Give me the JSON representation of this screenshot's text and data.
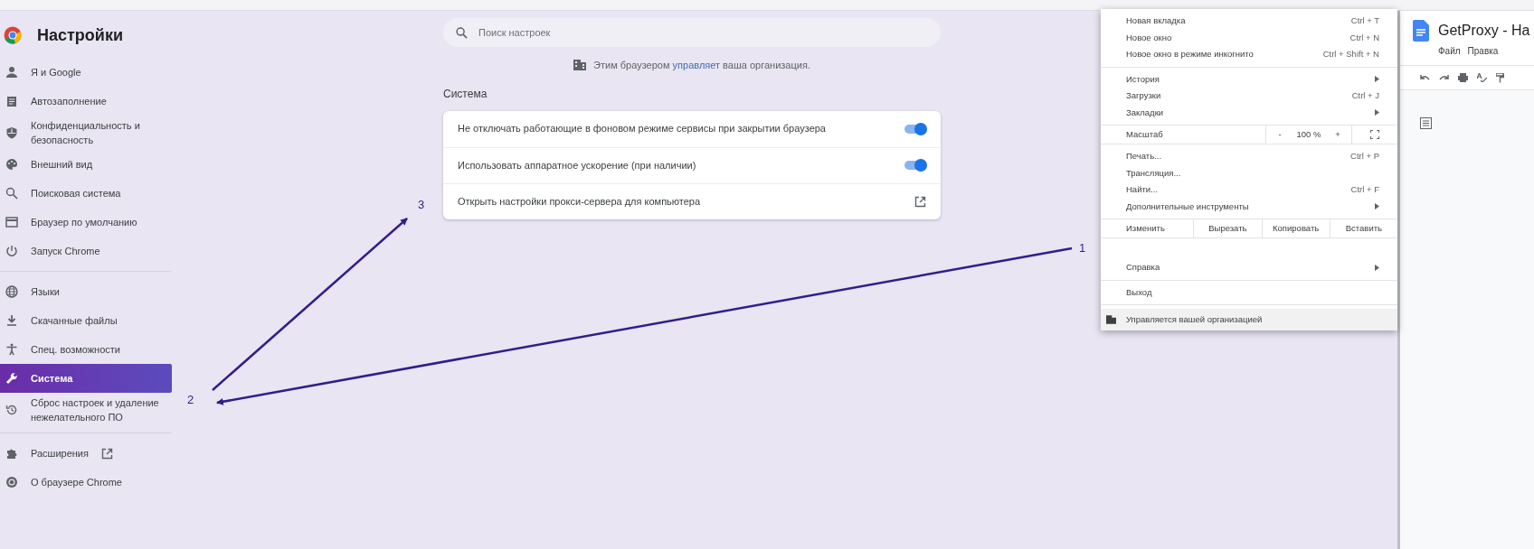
{
  "sidebar": {
    "title": "Настройки",
    "groups": [
      [
        {
          "label": "Я и Google",
          "selected": false,
          "external": false
        },
        {
          "label": "Автозаполнение",
          "selected": false,
          "external": false
        },
        {
          "label": "Конфиденциальность и безопасность",
          "selected": false,
          "external": false
        },
        {
          "label": "Внешний вид",
          "selected": false,
          "external": false
        },
        {
          "label": "Поисковая система",
          "selected": false,
          "external": false
        },
        {
          "label": "Браузер по умолчанию",
          "selected": false,
          "external": false
        },
        {
          "label": "Запуск Chrome",
          "selected": false,
          "external": false
        }
      ],
      [
        {
          "label": "Языки",
          "selected": false,
          "external": false
        },
        {
          "label": "Скачанные файлы",
          "selected": false,
          "external": false
        },
        {
          "label": "Спец. возможности",
          "selected": false,
          "external": false
        },
        {
          "label": "Система",
          "selected": true,
          "external": false
        },
        {
          "label": "Сброс настроек и удаление нежелательного ПО",
          "selected": false,
          "external": false
        }
      ],
      [
        {
          "label": "Расширения",
          "selected": false,
          "external": true
        },
        {
          "label": "О браузере Chrome",
          "selected": false,
          "external": false
        }
      ]
    ]
  },
  "search": {
    "placeholder": "Поиск настроек"
  },
  "managed_notice": {
    "before": "Этим браузером",
    "link": "управляет",
    "after": "ваша организация."
  },
  "section": {
    "title": "Система",
    "rows": [
      {
        "kind": "toggle",
        "label": "Не отключать работающие в фоновом режиме сервисы при закрытии браузера",
        "on": true
      },
      {
        "kind": "toggle",
        "label": "Использовать аппаратное ускорение (при наличии)",
        "on": true
      },
      {
        "kind": "link",
        "label": "Открыть настройки прокси-сервера для компьютера"
      }
    ]
  },
  "menu": {
    "items": [
      {
        "kind": "item",
        "label": "Новая вкладка",
        "shortcut": "Ctrl + T",
        "submenu": false
      },
      {
        "kind": "item",
        "label": "Новое окно",
        "shortcut": "Ctrl + N",
        "submenu": false
      },
      {
        "kind": "item",
        "label": "Новое окно в режиме инкогнито",
        "shortcut": "Ctrl + Shift + N",
        "submenu": false
      },
      {
        "kind": "divider"
      },
      {
        "kind": "item",
        "label": "История",
        "submenu": true
      },
      {
        "kind": "item",
        "label": "Загрузки",
        "shortcut": "Ctrl + J",
        "submenu": false
      },
      {
        "kind": "item",
        "label": "Закладки",
        "submenu": true
      },
      {
        "kind": "divider"
      },
      {
        "kind": "zoom",
        "label": "Масштаб",
        "minus": "-",
        "value": "100 %",
        "plus": "+"
      },
      {
        "kind": "divider"
      },
      {
        "kind": "item",
        "label": "Печать...",
        "shortcut": "Ctrl + P",
        "submenu": false
      },
      {
        "kind": "item",
        "label": "Трансляция...",
        "submenu": false
      },
      {
        "kind": "item",
        "label": "Найти...",
        "shortcut": "Ctrl + F",
        "submenu": false
      },
      {
        "kind": "item",
        "label": "Дополнительные инструменты",
        "submenu": true
      },
      {
        "kind": "divider"
      },
      {
        "kind": "edit",
        "buttons": [
          "Изменить",
          "Вырезать",
          "Копировать",
          "Вставить"
        ]
      },
      {
        "kind": "divider"
      },
      {
        "kind": "spacer"
      },
      {
        "kind": "item",
        "label": "Справка",
        "submenu": true
      },
      {
        "kind": "divider"
      },
      {
        "kind": "item",
        "label": "Выход",
        "submenu": false
      },
      {
        "kind": "divider"
      },
      {
        "kind": "managed",
        "label": "Управляется вашей организацией"
      }
    ]
  },
  "doc_window": {
    "title": "GetProxy - На",
    "menus": [
      "Файл",
      "Правка"
    ]
  },
  "annotations": [
    {
      "label": "1"
    },
    {
      "label": "2"
    },
    {
      "label": "3"
    }
  ]
}
